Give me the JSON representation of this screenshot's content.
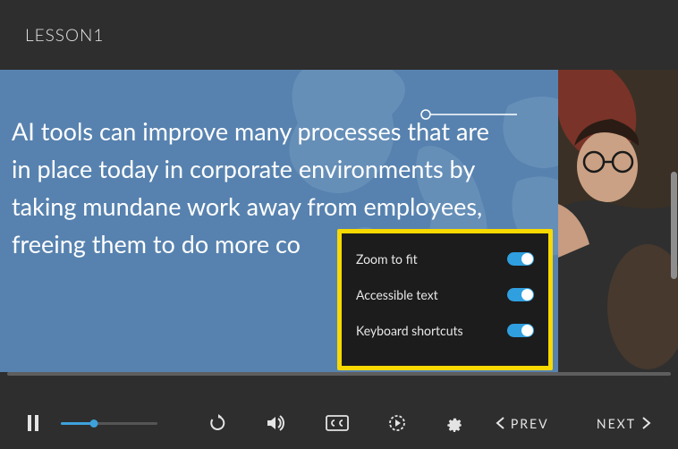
{
  "header": {
    "title": "LESSON1"
  },
  "slide": {
    "text": "AI tools can improve many processes that are in place today in corporate environments by taking mundane work away from employees, freeing them to do more co"
  },
  "settings": {
    "items": [
      {
        "label": "Zoom to fit",
        "on": true
      },
      {
        "label": "Accessible text",
        "on": true
      },
      {
        "label": "Keyboard shortcuts",
        "on": true
      }
    ]
  },
  "controls": {
    "seek_percent": 34,
    "prev_label": "PREV",
    "next_label": "NEXT"
  },
  "icons": {
    "pause": "pause",
    "replay": "replay",
    "volume": "volume",
    "cc": "cc",
    "playback": "playback",
    "gear": "gear",
    "chevron_left": "chevron-left",
    "chevron_right": "chevron-right"
  }
}
